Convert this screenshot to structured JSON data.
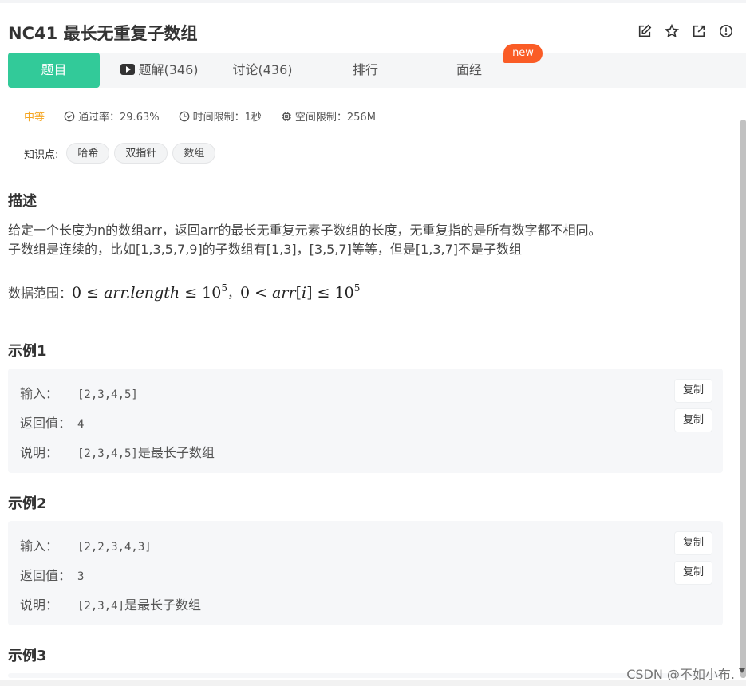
{
  "problem": {
    "title": "NC41  最长无重复子数组"
  },
  "header_icons": [
    "edit-icon",
    "star-icon",
    "share-icon",
    "info-icon"
  ],
  "tabs": [
    {
      "label": "题目",
      "active": true
    },
    {
      "label": "题解(346)",
      "icon": "video-icon"
    },
    {
      "label": "讨论(436)"
    },
    {
      "label": "排行"
    },
    {
      "label": "面经"
    }
  ],
  "new_badge": "new",
  "meta": {
    "difficulty": "中等",
    "pass_rate": "通过率：29.63%",
    "time_limit": "时间限制：1秒",
    "space_limit": "空间限制：256M"
  },
  "tags": {
    "label": "知识点:",
    "items": [
      "哈希",
      "双指针",
      "数组"
    ]
  },
  "description": {
    "heading": "描述",
    "line1": "给定一个长度为n的数组arr，返回arr的最长无重复元素子数组的长度，无重复指的是所有数字都不相同。",
    "line2": "子数组是连续的，比如[1,3,5,7,9]的子数组有[1,3]，[3,5,7]等等，但是[1,3,7]不是子数组",
    "range_label": "数据范围：",
    "range_part1_a": "0 ≤ ",
    "range_part1_var": "arr.length",
    "range_part1_b": " ≤ 10",
    "range_exp": "5",
    "range_sep": "，",
    "range_part2_a": "0 < ",
    "range_part2_var": "arr",
    "range_part2_b": "[",
    "range_part2_idx": "i",
    "range_part2_c": "] ≤ 10"
  },
  "examples": [
    {
      "heading": "示例1",
      "input_label": "输入：",
      "input_value": "[2,3,4,5]",
      "output_label": "返回值：",
      "output_value": "4",
      "explain_label": "说明：",
      "explain_code": "[2,3,4,5]",
      "explain_text": "是最长子数组"
    },
    {
      "heading": "示例2",
      "input_label": "输入：",
      "input_value": "[2,2,3,4,3]",
      "output_label": "返回值：",
      "output_value": "3",
      "explain_label": "说明：",
      "explain_code": "[2,3,4]",
      "explain_text": "是最长子数组"
    },
    {
      "heading": "示例3"
    }
  ],
  "copy_label": "复制",
  "watermark": "CSDN @不如小布.",
  "colors": {
    "accent": "#32ca99",
    "badge": "#fa5c26",
    "difficulty": "#f5a623"
  }
}
